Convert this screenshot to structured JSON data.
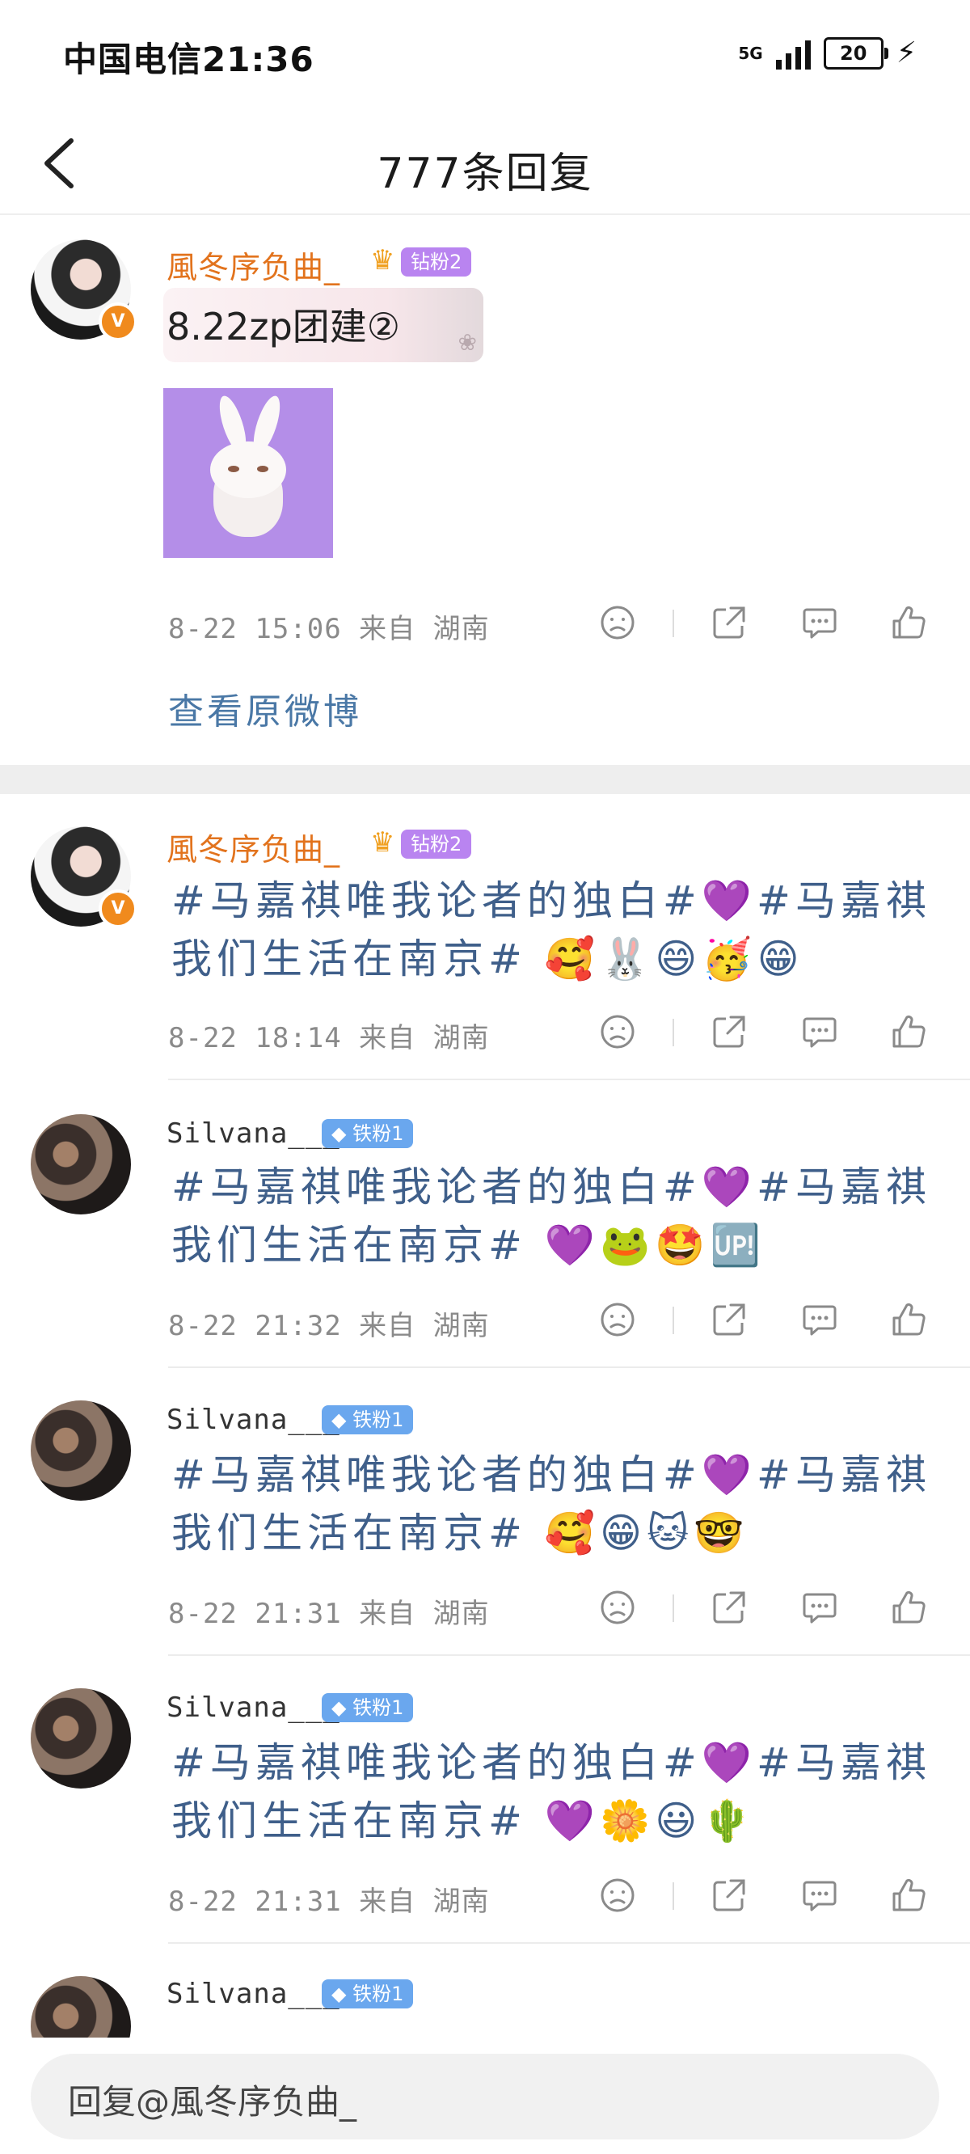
{
  "status_bar": {
    "carrier_time": "中国电信21:36",
    "network": "5G",
    "battery": "20"
  },
  "nav": {
    "title": "777条回复"
  },
  "original_post": {
    "username": "風冬序负曲_",
    "fan_badge": "钻粉2",
    "crown_level": "5",
    "bubble_text": "8.22zp团建②",
    "meta": "8-22 15:06 来自 湖南",
    "view_original": "查看原微博"
  },
  "replies": [
    {
      "username": "風冬序负曲_",
      "fan_badge": "钻粉2",
      "crown_level": "5",
      "text": "#马嘉祺唯我论者的独白#💜#马嘉祺我们生活在南京# 🥰🐰😄🥳😁",
      "meta": "8-22 18:14 来自 湖南"
    },
    {
      "username": "Silvana___",
      "fan_badge": "铁粉1",
      "text": "#马嘉祺唯我论者的独白#💜#马嘉祺我们生活在南京# 💜🐸🤩🆙",
      "meta": "8-22 21:32 来自 湖南"
    },
    {
      "username": "Silvana___",
      "fan_badge": "铁粉1",
      "text": "#马嘉祺唯我论者的独白#💜#马嘉祺我们生活在南京# 🥰😁🐱🤓",
      "meta": "8-22 21:31 来自 湖南"
    },
    {
      "username": "Silvana___",
      "fan_badge": "铁粉1",
      "text": "#马嘉祺唯我论者的独白#💜#马嘉祺我们生活在南京# 💜🌼😃🌵",
      "meta": "8-22 21:31 来自 湖南"
    },
    {
      "username": "Silvana___",
      "fan_badge": "铁粉1"
    }
  ],
  "reply_bar": {
    "placeholder": "回复@風冬序负曲_"
  },
  "colors": {
    "username_orange": "#e2731d",
    "topic_blue": "#3f5f8a",
    "diamond_badge": "#b984f0",
    "iron_badge": "#6aa7ee"
  },
  "icons": [
    "chevron-left-icon",
    "sad-face-icon",
    "share-icon",
    "comment-icon",
    "like-icon",
    "crown-icon",
    "diamond-icon",
    "verified-icon"
  ]
}
